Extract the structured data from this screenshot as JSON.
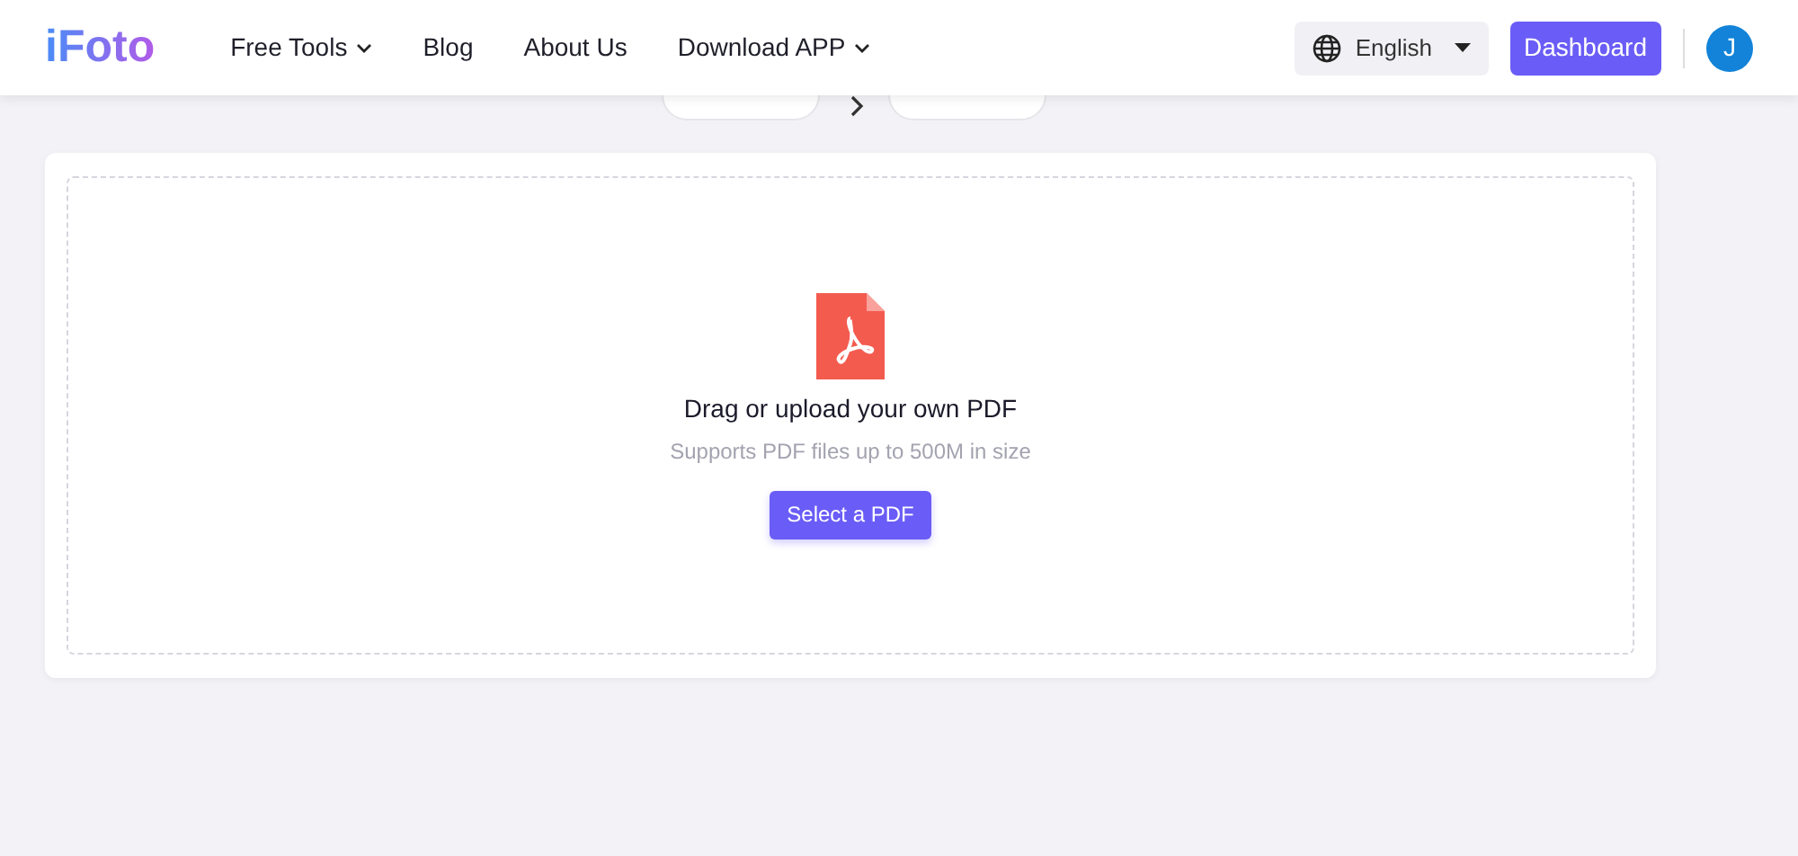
{
  "logo": "iFoto",
  "nav": [
    {
      "label": "Free Tools",
      "dropdown": true
    },
    {
      "label": "Blog",
      "dropdown": false
    },
    {
      "label": "About Us",
      "dropdown": false
    },
    {
      "label": "Download APP",
      "dropdown": true
    }
  ],
  "language": {
    "label": "English"
  },
  "dashboard_button": "Dashboard",
  "avatar": {
    "initial": "J"
  },
  "upload": {
    "title": "Drag or upload your own PDF",
    "subtitle": "Supports PDF files up to 500M in size",
    "button": "Select a PDF"
  }
}
